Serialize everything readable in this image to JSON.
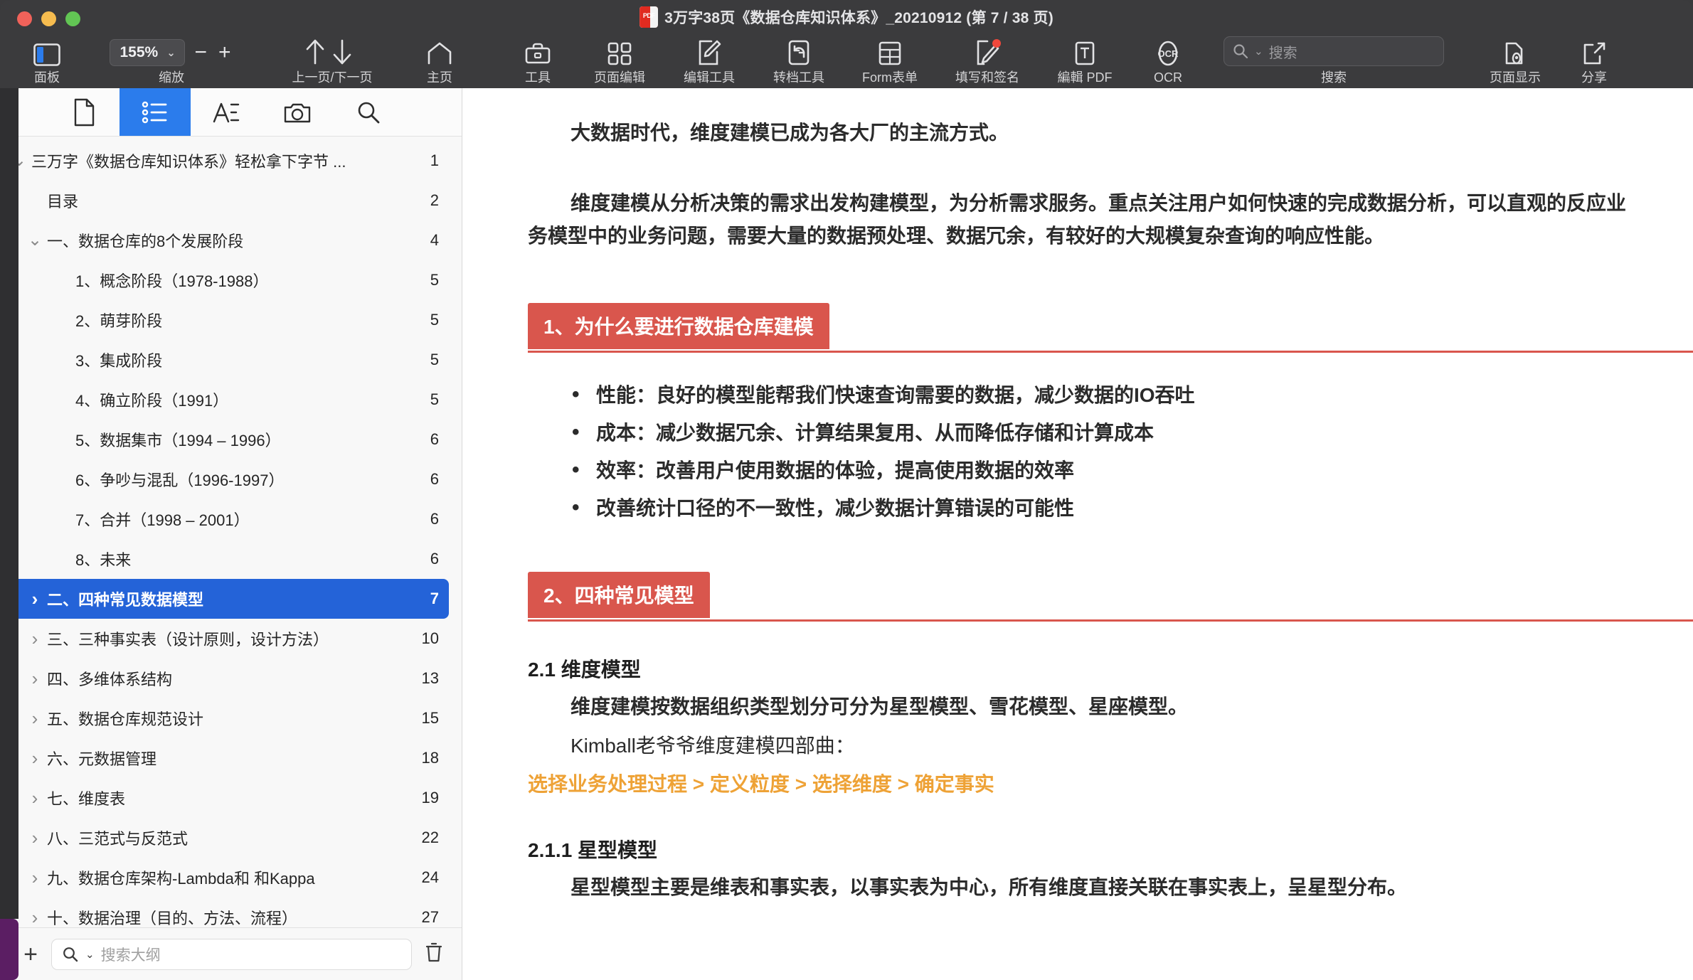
{
  "window": {
    "title": "3万字38页《数据仓库知识体系》_20210912 (第 7 / 38 页)",
    "file_type_badge": "PDF"
  },
  "toolbar": {
    "panel_label": "面板",
    "zoom_label": "缩放",
    "zoom_value": "155%",
    "zoom_out": "−",
    "zoom_in": "+",
    "pages_label": "上一页/下一页",
    "home_label": "主页",
    "tools_label": "工具",
    "page_edit_label": "页面编辑",
    "edit_tools_label": "编辑工具",
    "convert_tools_label": "转档工具",
    "form_label": "Form表单",
    "fill_sign_label": "填写和签名",
    "edit_pdf_label": "編輯 PDF",
    "ocr_label": "OCR",
    "ocr_icon_text": "OCR",
    "search_label": "搜索",
    "search_placeholder": "搜索",
    "search_value": "",
    "page_display_label": "页面显示",
    "share_label": "分享"
  },
  "sidebar": {
    "tabs": [
      {
        "name": "thumbnails",
        "icon": "page-icon",
        "active": false
      },
      {
        "name": "outline",
        "icon": "list-icon",
        "active": true
      },
      {
        "name": "annotations",
        "icon": "text-annotation-icon",
        "active": false
      },
      {
        "name": "snapshot",
        "icon": "camera-icon",
        "active": false
      },
      {
        "name": "search",
        "icon": "search-icon",
        "active": false
      }
    ],
    "outline_items": [
      {
        "label": "三万字《数据仓库知识体系》轻松拿下字节 ...",
        "page": "1",
        "level": 0,
        "twisty": "down",
        "selected": false
      },
      {
        "label": "目录",
        "page": "2",
        "level": 1,
        "twisty": "",
        "selected": false
      },
      {
        "label": "一、数据仓库的8个发展阶段",
        "page": "4",
        "level": 1,
        "twisty": "down",
        "selected": false
      },
      {
        "label": "1、概念阶段（1978-1988）",
        "page": "5",
        "level": 2,
        "twisty": "",
        "selected": false
      },
      {
        "label": "2、萌芽阶段",
        "page": "5",
        "level": 2,
        "twisty": "",
        "selected": false
      },
      {
        "label": "3、集成阶段",
        "page": "5",
        "level": 2,
        "twisty": "",
        "selected": false
      },
      {
        "label": "4、确立阶段（1991）",
        "page": "5",
        "level": 2,
        "twisty": "",
        "selected": false
      },
      {
        "label": "5、数据集市（1994 – 1996）",
        "page": "6",
        "level": 2,
        "twisty": "",
        "selected": false
      },
      {
        "label": "6、争吵与混乱（1996-1997）",
        "page": "6",
        "level": 2,
        "twisty": "",
        "selected": false
      },
      {
        "label": "7、合并（1998 – 2001）",
        "page": "6",
        "level": 2,
        "twisty": "",
        "selected": false
      },
      {
        "label": "8、未来",
        "page": "6",
        "level": 2,
        "twisty": "",
        "selected": false
      },
      {
        "label": "二、四种常见数据模型",
        "page": "7",
        "level": 1,
        "twisty": "right",
        "selected": true
      },
      {
        "label": "三、三种事实表（设计原则，设计方法）",
        "page": "10",
        "level": 1,
        "twisty": "right",
        "selected": false
      },
      {
        "label": "四、多维体系结构",
        "page": "13",
        "level": 1,
        "twisty": "right",
        "selected": false
      },
      {
        "label": "五、数据仓库规范设计",
        "page": "15",
        "level": 1,
        "twisty": "right",
        "selected": false
      },
      {
        "label": "六、元数据管理",
        "page": "18",
        "level": 1,
        "twisty": "right",
        "selected": false
      },
      {
        "label": "七、维度表",
        "page": "19",
        "level": 1,
        "twisty": "right",
        "selected": false
      },
      {
        "label": "八、三范式与反范式",
        "page": "22",
        "level": 1,
        "twisty": "right",
        "selected": false
      },
      {
        "label": "九、数据仓库架构-Lambda和 和Kappa",
        "page": "24",
        "level": 1,
        "twisty": "right",
        "selected": false
      },
      {
        "label": "十、数据治理（目的、方法、流程）",
        "page": "27",
        "level": 1,
        "twisty": "right",
        "selected": false
      }
    ],
    "add_label": "+",
    "search_placeholder": "搜索大纲",
    "search_value": ""
  },
  "document": {
    "para_1": "大数据时代，维度建模已成为各大厂的主流方式。",
    "para_2": "维度建模从分析决策的需求出发构建模型，为分析需求服务。重点关注用户如何快速的完成数据分析，可以直观的反应业务模型中的业务问题，需要大量的数据预处理、数据冗余，有较好的大规模复杂查询的响应性能。",
    "section_1_title": "1、为什么要进行数据仓库建模",
    "bullets": [
      "性能：良好的模型能帮我们快速查询需要的数据，减少数据的IO吞吐",
      "成本：减少数据冗余、计算结果复用、从而降低存储和计算成本",
      "效率：改善用户使用数据的体验，提高使用数据的效率",
      "改善统计口径的不一致性，减少数据计算错误的可能性"
    ],
    "section_2_title": "2、四种常见模型",
    "h_2_1": "2.1 维度模型",
    "p_2_1_a": "维度建模按数据组织类型划分可分为星型模型、雪花模型、星座模型。",
    "p_2_1_b": "Kimball老爷爷维度建模四部曲：",
    "orange_steps": "选择业务处理过程 > 定义粒度 > 选择维度 > 确定事实",
    "h_2_1_1": "2.1.1 星型模型",
    "p_2_1_1": "星型模型主要是维表和事实表，以事实表为中心，所有维度直接关联在事实表上，呈星型分布。"
  },
  "colors": {
    "toolbar_bg": "#3b3b3d",
    "accent_blue": "#2463d8",
    "tab_blue": "#2b7cec",
    "section_red": "#d9564d",
    "orange_text": "#eea236",
    "purple_tab": "#5b1e63"
  }
}
